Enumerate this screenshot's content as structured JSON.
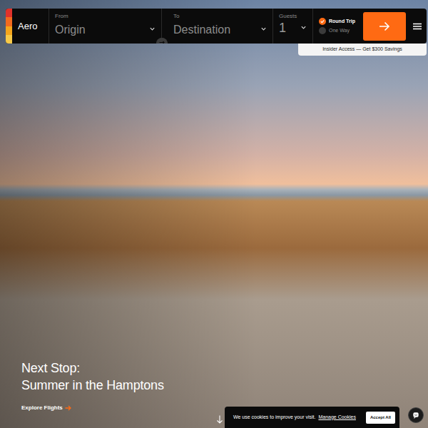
{
  "brand": {
    "name": "Aero"
  },
  "search": {
    "from": {
      "label": "From",
      "placeholder": "Origin"
    },
    "to": {
      "label": "To",
      "placeholder": "Destination"
    },
    "guests": {
      "label": "Guests",
      "value": "1"
    },
    "trip_types": [
      {
        "label": "Round Trip",
        "selected": true
      },
      {
        "label": "One Way",
        "selected": false
      }
    ]
  },
  "promo": "Insider Access — Get $300 Savings",
  "hero": {
    "line1": "Next Stop:",
    "line2": "Summer in the Hamptons",
    "cta": "Explore Flights"
  },
  "cookie": {
    "text": "We use cookies to improve your visit.",
    "link": "Manage Cookies",
    "button": "Accept All"
  }
}
